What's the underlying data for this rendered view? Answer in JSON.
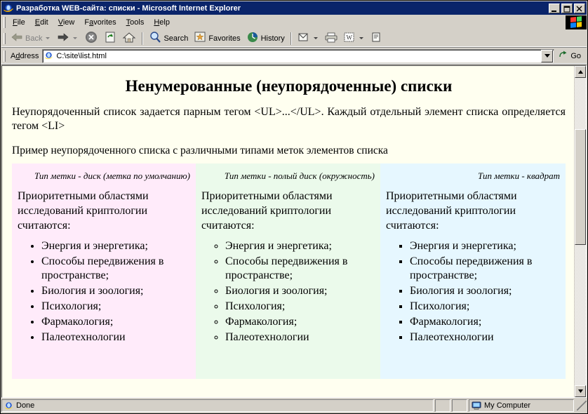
{
  "window": {
    "title": "Разработка WEB-сайта: списки - Microsoft Internet Explorer",
    "icon": "internet-explorer-icon",
    "minimize_label": "_",
    "maximize_label": "□",
    "close_label": "✕"
  },
  "menu": {
    "items": [
      {
        "label": "File",
        "accel": "F"
      },
      {
        "label": "Edit",
        "accel": "E"
      },
      {
        "label": "View",
        "accel": "V"
      },
      {
        "label": "Favorites",
        "accel": "a"
      },
      {
        "label": "Tools",
        "accel": "T"
      },
      {
        "label": "Help",
        "accel": "H"
      }
    ]
  },
  "toolbar": {
    "back_label": "Back",
    "forward_label": "",
    "stop_label": "",
    "refresh_label": "",
    "home_label": "",
    "search_label": "Search",
    "favorites_label": "Favorites",
    "history_label": "History",
    "mail_label": "",
    "print_label": "",
    "edit_label": "",
    "discuss_label": ""
  },
  "address": {
    "label": "Address",
    "value": "C:\\site\\list.html",
    "placeholder": "",
    "go_label": "Go"
  },
  "page": {
    "title": "Ненумерованные (неупорядоченные) списки",
    "intro": "Неупорядоченный список задается парным тегом <UL>...</UL>. Каждый отдельный элемент списка определяется тегом <LI>",
    "example_caption": "Пример неупорядоченного списка с различными типами меток элементов списка",
    "columns": [
      {
        "header": "Тип метки - диск (метка по умолчанию)",
        "intro": "Приоритетными областями исследований криптологии считаются:",
        "bullet_style": "disc",
        "bg": "#FFEBFA",
        "items": [
          "Энергия и энергетика;",
          "Способы передвижения в пространстве;",
          "Биология и зоология;",
          "Психология;",
          "Фармакология;",
          "Палеотехнологии"
        ]
      },
      {
        "header": "Тип метки - полый диск (окружность)",
        "intro": "Приоритетными областями исследований криптологии считаются:",
        "bullet_style": "circle",
        "bg": "#EBFAEB",
        "items": [
          "Энергия и энергетика;",
          "Способы передвижения в пространстве;",
          "Биология и зоология;",
          "Психология;",
          "Фармакология;",
          "Палеотехнологии"
        ]
      },
      {
        "header": "Тип метки - квадрат",
        "intro": "Приоритетными областями исследований криптологии считаются:",
        "bullet_style": "square",
        "bg": "#E6F7FF",
        "items": [
          "Энергия и энергетика;",
          "Способы передвижения в пространстве;",
          "Биология и зоология;",
          "Психология;",
          "Фармакология;",
          "Палеотехнологии"
        ]
      }
    ]
  },
  "statusbar": {
    "status": "Done",
    "zone": "My Computer"
  },
  "colors": {
    "titlebar": "#0A246A",
    "chrome": "#D4D0C8",
    "page_bg": "#FFFFF0"
  }
}
